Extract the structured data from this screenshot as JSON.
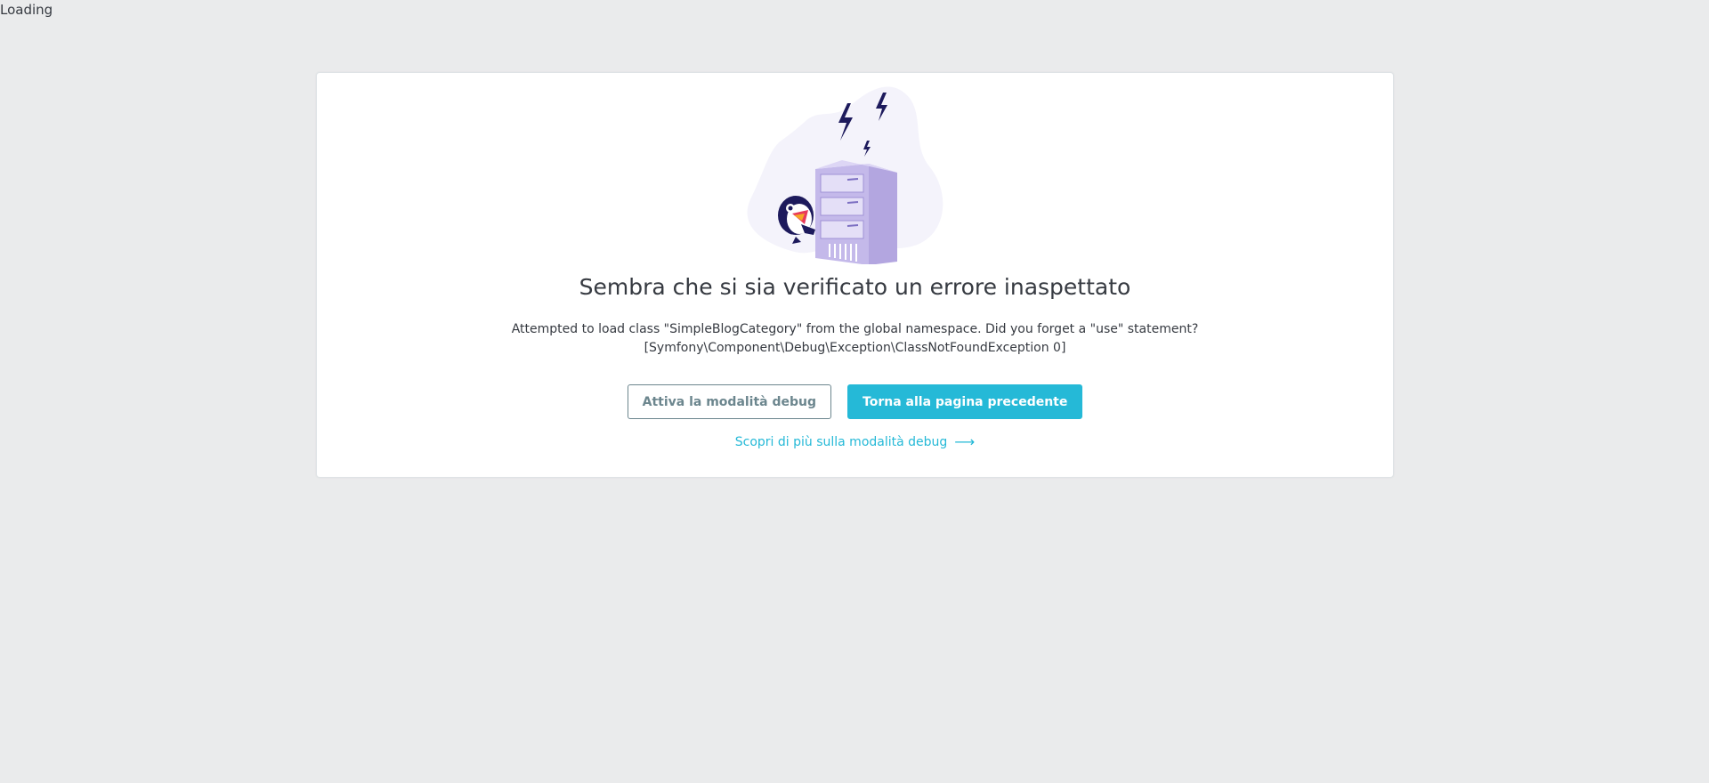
{
  "status": {
    "loading_text": "Loading"
  },
  "error_card": {
    "title": "Sembra che si sia verificato un errore inaspettato",
    "message_line1": "Attempted to load class \"SimpleBlogCategory\" from the global namespace. Did you forget a \"use\" statement?",
    "message_line2": "[Symfony\\Component\\Debug\\Exception\\ClassNotFoundException 0]",
    "illustration_icon": "server-error-puffin-illustration"
  },
  "actions": {
    "debug_button_label": "Attiva la modalità debug",
    "back_button_label": "Torna alla pagina precedente",
    "learn_more_label": "Scopri di più sulla modalità debug",
    "learn_more_icon": "arrow-right-icon"
  },
  "colors": {
    "background": "#eaebec",
    "primary": "#25b9d7",
    "outline": "#6c868e",
    "illustration_purple": "#c0b6e8",
    "illustration_dark": "#1d1a5c"
  }
}
